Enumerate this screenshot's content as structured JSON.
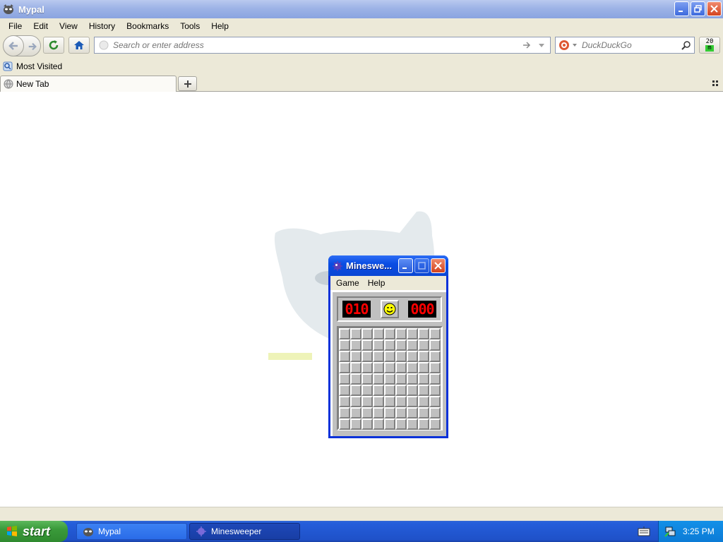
{
  "browser": {
    "title": "Mypal",
    "menu": [
      "File",
      "Edit",
      "View",
      "History",
      "Bookmarks",
      "Tools",
      "Help"
    ],
    "url_placeholder": "Search or enter address",
    "search_placeholder": "DuckDuckGo",
    "zoom_label_top": "20",
    "zoom_label_bottom": "m",
    "bookmark": "Most Visited",
    "tab_label": "New Tab"
  },
  "minesweeper": {
    "title": "Mineswe...",
    "menu": [
      "Game",
      "Help"
    ],
    "mine_counter": "010",
    "timer": "000",
    "rows": 9,
    "cols": 9
  },
  "taskbar": {
    "start_label": "start",
    "tasks": [
      "Mypal",
      "Minesweeper"
    ],
    "clock": "3:25 PM"
  }
}
